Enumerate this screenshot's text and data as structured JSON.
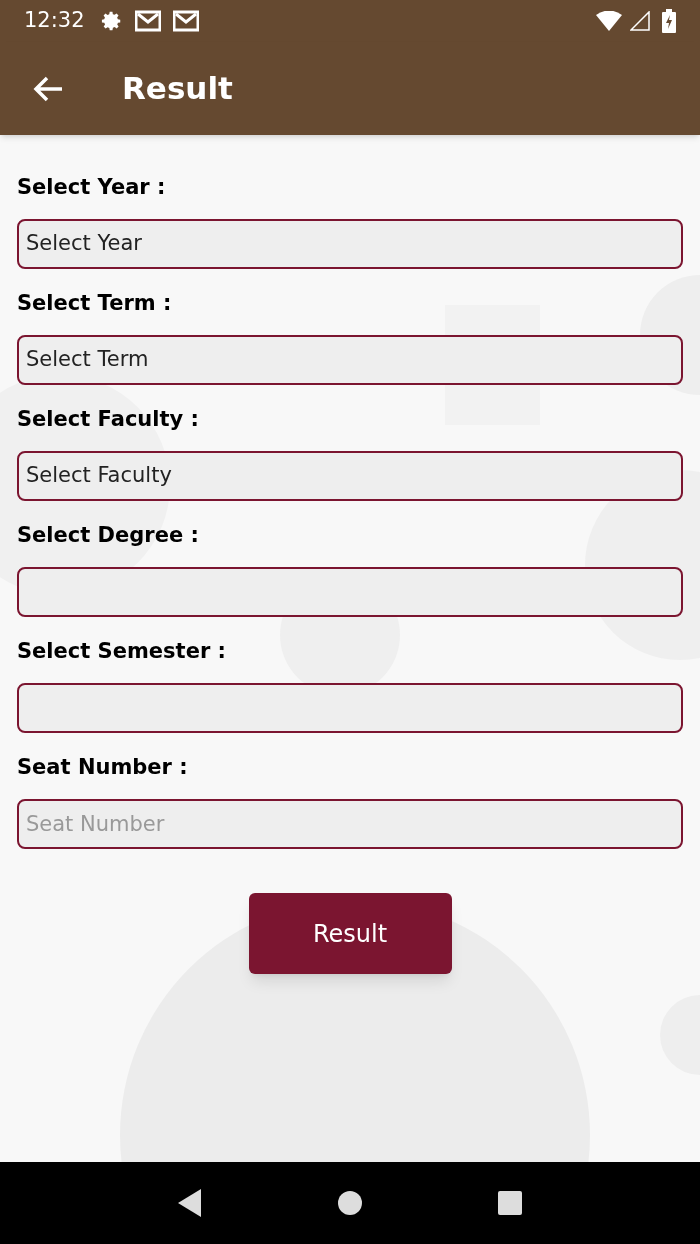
{
  "status_bar": {
    "time": "12:32"
  },
  "app_bar": {
    "title": "Result"
  },
  "fields": [
    {
      "label": "Select Year :",
      "kind": "select",
      "value": "Select Year"
    },
    {
      "label": "Select Term :",
      "kind": "select",
      "value": "Select Term"
    },
    {
      "label": "Select Faculty :",
      "kind": "select",
      "value": "Select Faculty"
    },
    {
      "label": "Select Degree :",
      "kind": "select"
    },
    {
      "label": "Select Semester :",
      "kind": "select"
    },
    {
      "label": "Seat Number :",
      "kind": "text",
      "placeholder": "Seat Number"
    }
  ],
  "submit_button": "Result"
}
